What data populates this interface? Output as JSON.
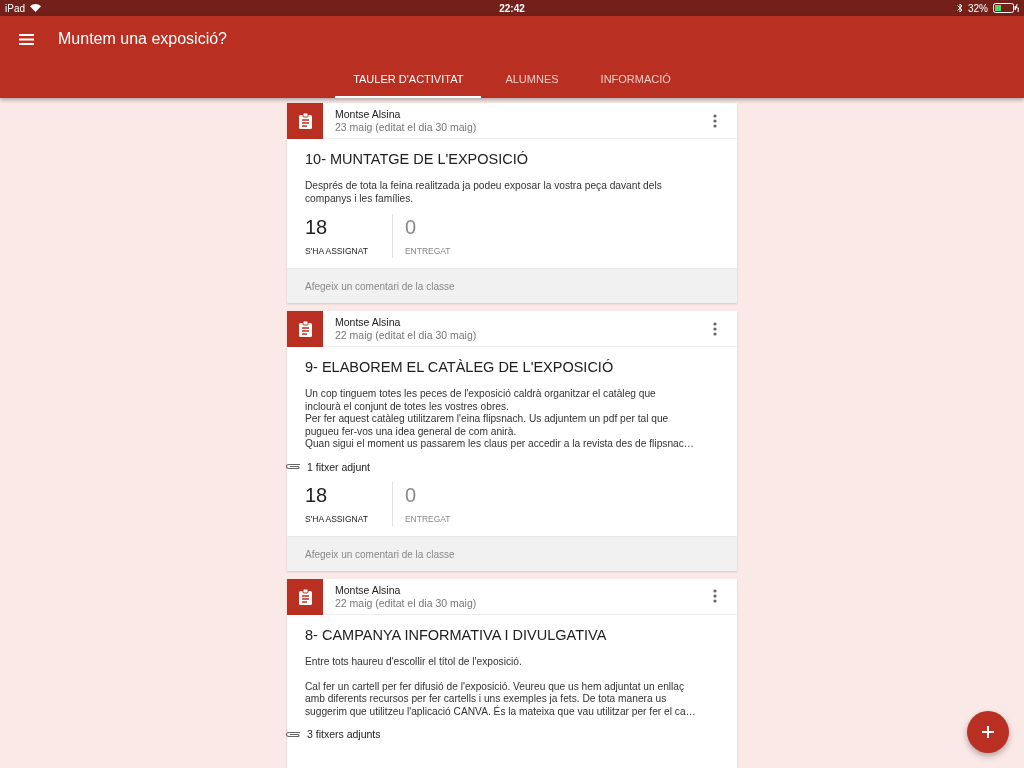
{
  "status_bar": {
    "device": "iPad",
    "time": "22:42",
    "battery": "32%"
  },
  "app_bar": {
    "title": "Muntem una exposició?"
  },
  "tabs": [
    {
      "label": "TAULER D'ACTIVITAT",
      "selected": true
    },
    {
      "label": "ALUMNES",
      "selected": false
    },
    {
      "label": "INFORMACIÓ",
      "selected": false
    }
  ],
  "posts": [
    {
      "author": "Montse Alsina",
      "date": "23 maig (editat el dia 30 maig)",
      "title": "10- MUNTATGE DE L'EXPOSICIÓ",
      "description": "Després de tota la feina realitzada ja podeu exposar la vostra peça davant dels\ncompanys i les famílies.",
      "stats": [
        {
          "value": "18",
          "label": "S'HA ASSIGNAT"
        },
        {
          "value": "0",
          "label": "ENTREGAT"
        }
      ],
      "comment_placeholder": "Afegeix un comentari de la classe"
    },
    {
      "author": "Montse Alsina",
      "date": "22 maig (editat el dia 30 maig)",
      "title": "9- ELABOREM EL CATÀLEG DE L'EXPOSICIÓ",
      "description": "Un cop tinguem totes les peces de l'exposició caldrà organitzar el catàleg que\ninclourà el conjunt de totes les vostres obres.\nPer fer aquest catàleg utilitzarem l'eina flipsnach. Us adjuntem un pdf per tal que\npugueu fer-vos una idea general de com anirà.\nQuan sigui el moment us passarem les claus per accedir a la revista des de flipsnac…",
      "attachments": "1 fitxer adjunt",
      "stats": [
        {
          "value": "18",
          "label": "S'HA ASSIGNAT"
        },
        {
          "value": "0",
          "label": "ENTREGAT"
        }
      ],
      "comment_placeholder": "Afegeix un comentari de la classe"
    },
    {
      "author": "Montse Alsina",
      "date": "22 maig (editat el dia 30 maig)",
      "title": "8- CAMPANYA INFORMATIVA I DIVULGATIVA",
      "description": "Entre tots haureu d'escollir el títol de l'exposició.\n\nCal fer un cartell per fer difusió de l'exposició. Veureu que us hem adjuntat un enllaç\namb diferents recursos per fer cartells i uns exemples ja fets. De tota manera us\nsuggerim que utilitzeu l'aplicació CANVA. És la mateixa que vau utilitzar per fer el ca…",
      "attachments": "3 fitxers adjunts"
    }
  ]
}
